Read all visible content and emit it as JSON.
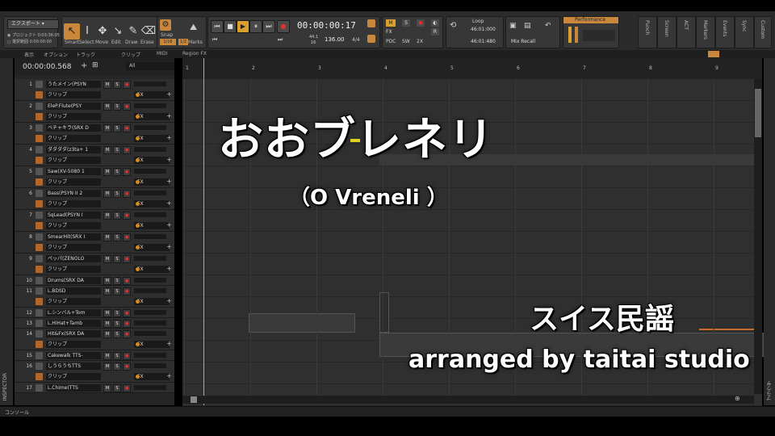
{
  "topbar": {
    "export_label": "エクスポート",
    "project_label": "プロジェクト",
    "project_time": "0:03:36:05",
    "selection_label": "選択範囲",
    "selection_time": "0:00:00:00"
  },
  "tools": {
    "smart": "Smart",
    "select": "Select",
    "move": "Move",
    "edit": "Edit",
    "draw": "Draw",
    "erase": "Erase",
    "snap_label": "Snap",
    "snap_value": "1/16",
    "snap_value2": "1/2",
    "marks_label": "Marks"
  },
  "transport": {
    "time": "00:00:00:17",
    "tempo": "136.00",
    "meter": "4/4",
    "val44": "44.1",
    "val16": "16",
    "loop_label": "Loop",
    "loop_start": "46:01:000",
    "loop_end": "46:01:480",
    "mix_recall": "Mix Recall",
    "performance_label": "Performance",
    "pdc": "PDC",
    "twox": "2X",
    "m": "M",
    "fx": "FX",
    "r": "R",
    "sw": "SW"
  },
  "side_tabs": [
    "Punch",
    "Screen",
    "ACT",
    "Markers",
    "Events",
    "Sync",
    "Custom"
  ],
  "menus": [
    "表示",
    "オプション",
    "トラック",
    "クリップ",
    "MIDI",
    "Region FX"
  ],
  "track_header": {
    "time": "00:00:00.568",
    "filter": "All"
  },
  "ruler_marks": [
    "1",
    "2",
    "3",
    "4",
    "5",
    "6",
    "7",
    "8",
    "9"
  ],
  "tracks": [
    {
      "num": "1",
      "name": "うたメイン(PSYN",
      "clip": "クリップ",
      "fx": "FX"
    },
    {
      "num": "2",
      "name": "EleP.Flute(PSY",
      "clip": "クリップ",
      "fx": "FX"
    },
    {
      "num": "3",
      "name": "ベチャキラ(SRX D",
      "clip": "クリップ",
      "fx": "FX"
    },
    {
      "num": "4",
      "name": "ダダダダ(z3ta+ 1",
      "clip": "クリップ",
      "fx": "FX"
    },
    {
      "num": "5",
      "name": "Saw(XV-5080 1",
      "clip": "クリップ",
      "fx": "FX"
    },
    {
      "num": "6",
      "name": "Bass(PSYN II 2",
      "clip": "クリップ",
      "fx": "FX"
    },
    {
      "num": "7",
      "name": "SqLead(PSYN I",
      "clip": "クリップ",
      "fx": "FX"
    },
    {
      "num": "8",
      "name": "SmearHit(SRX I",
      "clip": "クリップ",
      "fx": "FX"
    },
    {
      "num": "9",
      "name": "ペッパ(ZENOLO",
      "clip": "クリップ",
      "fx": "FX"
    }
  ],
  "small_tracks": [
    {
      "num": "10",
      "name": "Drums(SRX DA"
    },
    {
      "num": "11",
      "name": "L.BDSD",
      "clip": "クリップ",
      "fx": "FX"
    },
    {
      "num": "12",
      "name": "L.シンバル+Tom"
    },
    {
      "num": "13",
      "name": "L.HiHat+Tamb"
    },
    {
      "num": "14",
      "name": "Hit&Fx(SRX DA",
      "clip": "クリップ",
      "fx": "FX"
    },
    {
      "num": "15",
      "name": "Cakewalk TTS-"
    },
    {
      "num": "16",
      "name": "しうらうちTTS",
      "clip": "クリップ",
      "fx": "FX"
    },
    {
      "num": "17",
      "name": "L.Chime(TTS"
    }
  ],
  "inspector_label": "INSPECTOR",
  "browser_label": "ブラウザ",
  "console_label": "コンソール",
  "overlay": {
    "title": "おおブレネリ",
    "subtitle": "（O Vreneli ）",
    "origin": "スイス民謡",
    "credit": "arranged by taitai studio"
  }
}
